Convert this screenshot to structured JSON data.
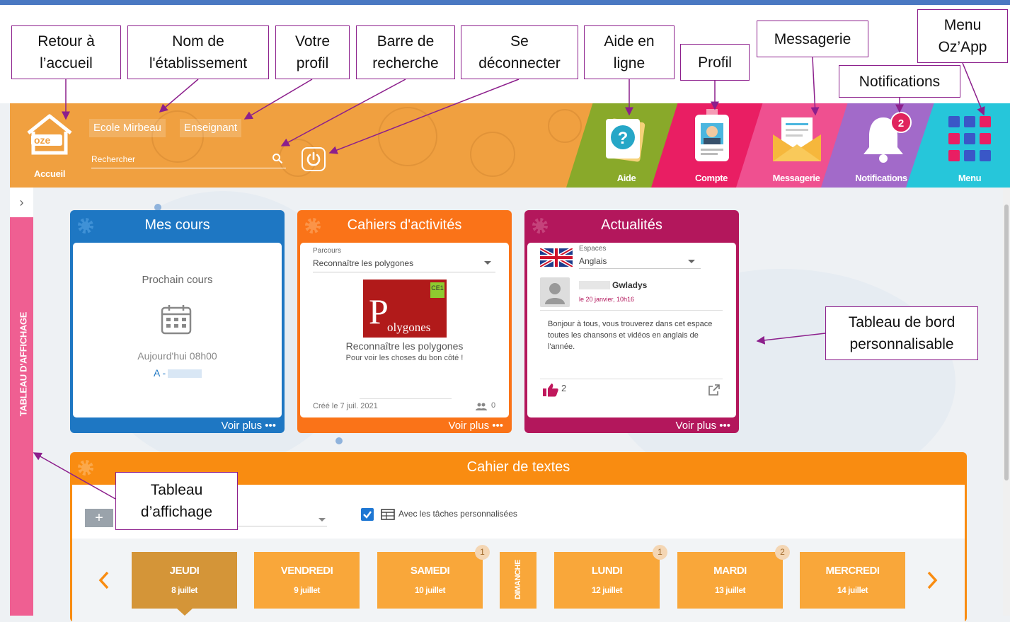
{
  "colors": {
    "header": "#f0a040",
    "aide": "#89a92a",
    "compte": "#e91e63",
    "messagerie": "#ef5090",
    "notifications": "#a26ac9",
    "menu": "#26c6da",
    "mes_cours": "#1e77c3",
    "cahiers": "#fa7318",
    "actualites": "#b3175c",
    "cahier_textes": "#f98c11",
    "side_panel": "#ef5f92",
    "annotation_border": "#8c1f8c",
    "day_selected": "#d49538",
    "day": "#f9a73a"
  },
  "annotations": {
    "retour": "Retour à\nl’accueil",
    "nom": "Nom de\nl'établissement",
    "profil": "Votre\nprofil",
    "recherche": "Barre de\nrecherche",
    "deconnecter": "Se\ndéconnecter",
    "aide": "Aide en\nligne",
    "profil2": "Profil",
    "messagerie": "Messagerie",
    "notifications": "Notifications",
    "menu": "Menu\nOz’App",
    "tableau_bord": "Tableau de bord\npersonnalisable",
    "tableau_affichage": "Tableau\nd’affichage"
  },
  "header": {
    "logo_text": "oze",
    "accueil": "Accueil",
    "school": "Ecole Mirbeau",
    "role": "Enseignant",
    "search_placeholder": "Rechercher",
    "tiles": {
      "aide": "Aide",
      "compte": "Compte",
      "messagerie": "Messagerie",
      "notifications": "Notifications",
      "menu": "Menu"
    },
    "notification_count": "2"
  },
  "side_panel": {
    "label": "TABLEAU D'AFFICHAGE",
    "toggle": "›"
  },
  "widgets": {
    "mes_cours": {
      "title": "Mes cours",
      "next_label": "Prochain cours",
      "time": "Aujourd'hui 08h00",
      "class": "A -",
      "more": "Voir plus •••"
    },
    "cahiers": {
      "title": "Cahiers d'activités",
      "field_label": "Parcours",
      "selected": "Reconnaître les polygones",
      "image_big": "P",
      "image_rest": "olygones",
      "image_badge": "CE1",
      "name": "Reconnaître les polygones",
      "desc": "Pour voir les choses du bon côté !",
      "created": "Créé le 7 juil. 2021",
      "members": "0",
      "more": "Voir plus •••"
    },
    "actualites": {
      "title": "Actualités",
      "field_label": "Espaces",
      "selected": "Anglais",
      "author": "Gwladys",
      "date": "le 20 janvier, 10h16",
      "message": "Bonjour à tous, vous trouverez dans cet espace toutes les chansons et vidéos en anglais de l'année.",
      "likes": "2",
      "more": "Voir plus •••"
    },
    "cahier_textes": {
      "title": "Cahier de textes",
      "checkbox_label": "Avec les tâches personnalisées",
      "checked": true
    }
  },
  "days": [
    {
      "name": "JEUDI",
      "date": "8 juillet",
      "badge": "",
      "selected": true
    },
    {
      "name": "VENDREDI",
      "date": "9 juillet",
      "badge": ""
    },
    {
      "name": "SAMEDI",
      "date": "10 juillet",
      "badge": "1"
    },
    {
      "name": "DIMANCHE",
      "date": "",
      "badge": ""
    },
    {
      "name": "LUNDI",
      "date": "12 juillet",
      "badge": "1"
    },
    {
      "name": "MARDI",
      "date": "13 juillet",
      "badge": "2"
    },
    {
      "name": "MERCREDI",
      "date": "14 juillet",
      "badge": ""
    }
  ]
}
